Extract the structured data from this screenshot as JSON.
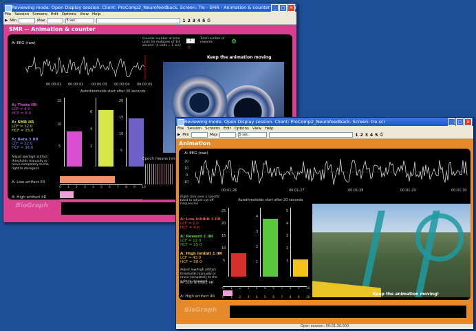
{
  "back": {
    "title": "Reviewing mode. Open Display session. Client: ProComp2_Neurofeedback. Screen: Tre - SMR - Animation & counter - 1 mon.scr",
    "menu": [
      "File",
      "Session",
      "Screens",
      "Edit",
      "Options",
      "View",
      "Help"
    ],
    "toolbar": {
      "min": "Min",
      "max": "Max",
      "interval": "5 sec.",
      "pages": [
        "1",
        "2",
        "3",
        "4",
        "5"
      ]
    },
    "header": "SMR -- Animation & counter",
    "eeg_label": "A: EEG (raw)",
    "time_ticks": [
      "00:00:01",
      "00:00:02",
      "00:00:03",
      "00:00:04",
      "00:00:05"
    ],
    "autothreshold": "Autothresholds start after 30 seconds",
    "counter_text": "Counter number at time units (in multiples of 1/4 second : 4 units = 1 sec)",
    "counter_value": "2",
    "total_label": "Total number of rewards",
    "total_value": "0",
    "small_zero": "0",
    "keep_moving": "Keep the animation moving",
    "epoch": "Epoch means (shown",
    "bands": [
      {
        "name": "A: Theta IIR",
        "lcf": "LCF = 4.0",
        "hcf": "HCF = 8.0",
        "color": "#d94fd0",
        "value": 9
      },
      {
        "name": "A: SMR IIR",
        "lcf": "LCF = 12.0",
        "hcf": "HCF = 15.0",
        "color": "#d6e64a",
        "value": 6
      },
      {
        "name": "A: Beta 3 IIR",
        "lcf": "LCF = 22.0",
        "hcf": "HCF = 36.0",
        "color": "#6d60c8",
        "value": 16
      }
    ],
    "scales": [
      [
        "15",
        "10",
        "5"
      ],
      [
        "6",
        "4",
        "2"
      ],
      [
        "20",
        "15",
        "10",
        "5"
      ]
    ],
    "adjust_text": "Adjust low/high artifact thresholds manually or move completely to the right to disregard.",
    "low_artifact": "A: Low artifact IIR",
    "high_artifact": "A: High artifact IIR",
    "axis_ticks": [
      "0",
      "1",
      "2",
      "3",
      "4",
      "5",
      "6",
      "7",
      "8",
      "9",
      "10"
    ],
    "logo": "BioGraph"
  },
  "front": {
    "title": "Reviewing mode. Open Display session. Client: ProComp2_Neurofeedback. Screen: tre.scr",
    "menu": [
      "File",
      "Session",
      "Screens",
      "Edit",
      "Options",
      "View",
      "Help"
    ],
    "toolbar": {
      "min": "Min",
      "max": "Max",
      "interval": "5 sec.",
      "pages": [
        "1",
        "2",
        "3",
        "4",
        "5"
      ]
    },
    "header": "Animation",
    "eeg_label": "A: EEG (raw)",
    "eeg_scale": [
      "20",
      "10",
      "0",
      "-10"
    ],
    "time_ticks": [
      "00:01:26",
      "00:01:27",
      "00:01:28",
      "00:01:29",
      "00:01:30"
    ],
    "side_note": "Right-click over a specific band to adjust cut-off frequencies",
    "autothreshold": "Autothresholds start after 20 seconds",
    "bands": [
      {
        "name": "A: Low Inhibit 1 IIR",
        "lcf": "LCF = 1.0",
        "hcf": "HCF = 4.0",
        "color": "#d6302a",
        "value": 10
      },
      {
        "name": "A: Reward 1 IIR",
        "lcf": "LCF = 12.0",
        "hcf": "HCF = 15.0",
        "color": "#59c83e",
        "value": 4.2
      },
      {
        "name": "A: High Inhibit 1 IIR",
        "lcf": "LCF = 43.0",
        "hcf": "HCF = 58.0",
        "color": "#f2c21a",
        "value": 1.5
      }
    ],
    "scales": [
      [
        "25",
        "20",
        "15",
        "10",
        "5"
      ],
      [
        "4",
        "3",
        "2",
        "1"
      ],
      [
        "5",
        "4",
        "3",
        "2",
        "1"
      ]
    ],
    "adjust_text": "Adjust low/high artifact thresholds manually or move completely to the right to disregard.",
    "low_artifact": "A: Low artifact IIR",
    "high_artifact": "A: High artifact IIR",
    "axis_ticks": [
      "0",
      "1",
      "2",
      "3",
      "4",
      "5",
      "6",
      "7",
      "8",
      "9",
      "10"
    ],
    "keep_moving": "Keep the animation moving!",
    "logo": "BioGraph",
    "status": "Open session: 00:01:30.000"
  }
}
